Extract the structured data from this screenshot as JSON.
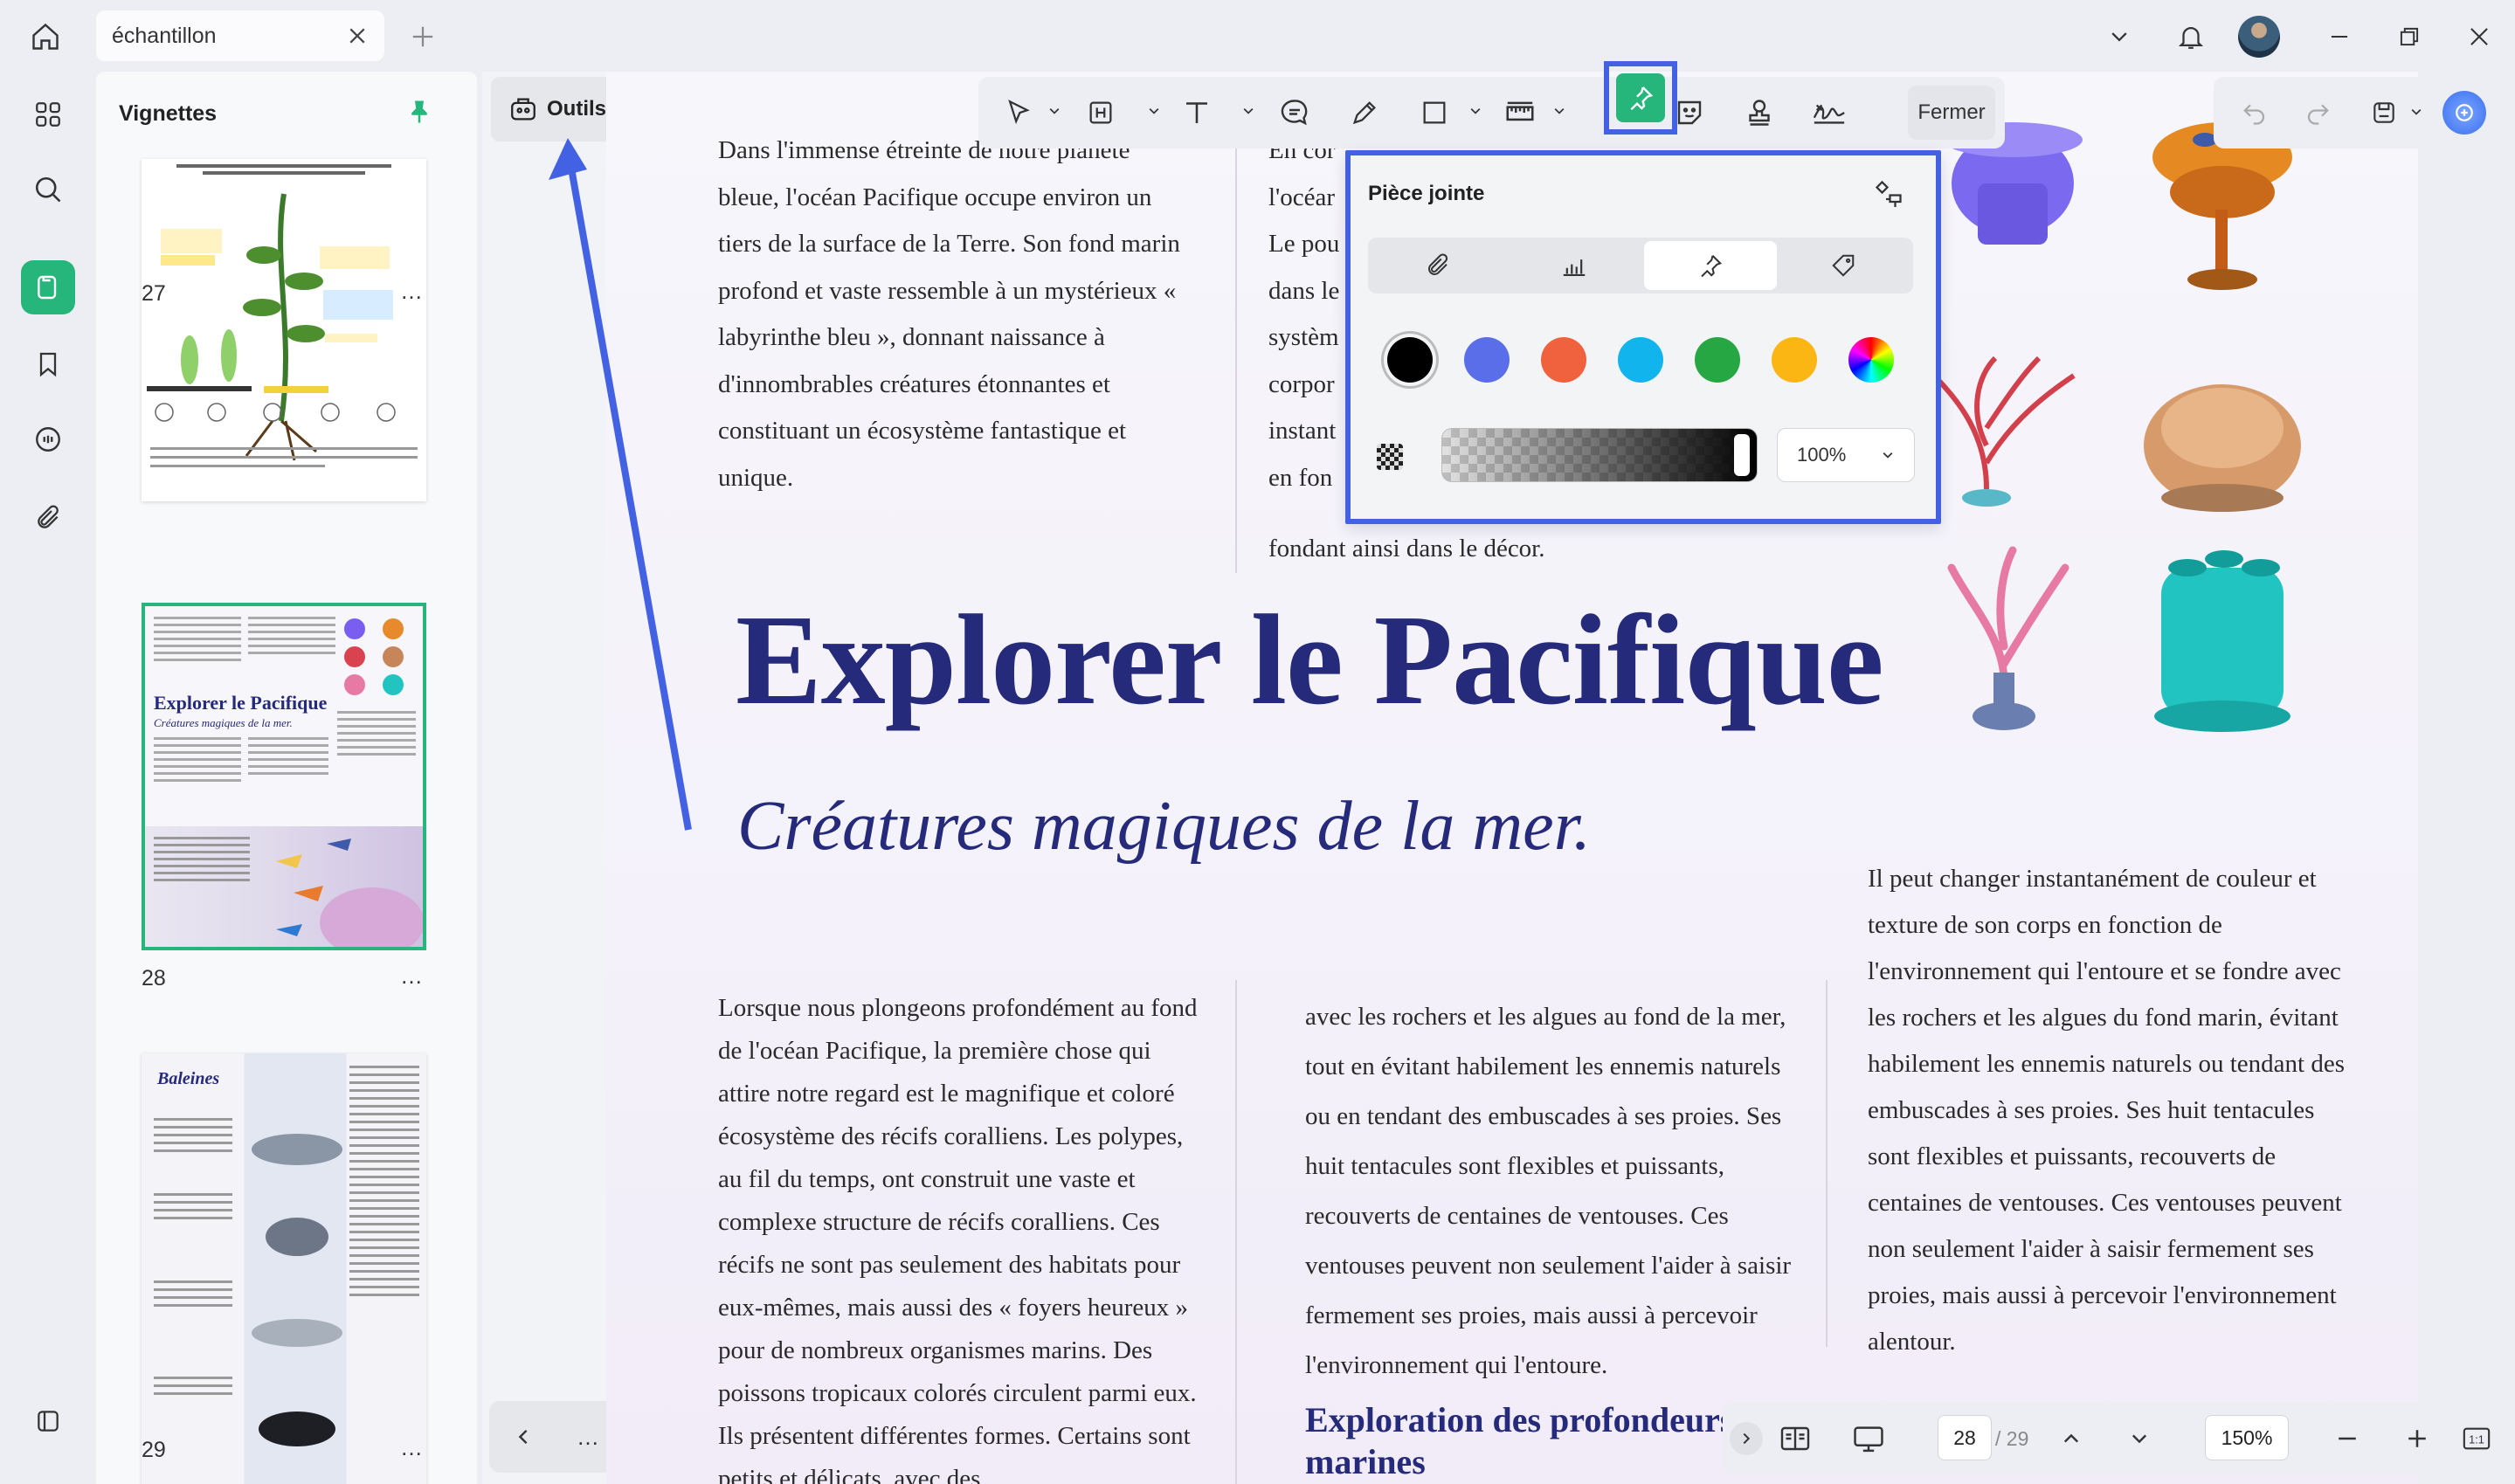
{
  "titlebar": {
    "tab_label": "échantillon"
  },
  "thumbnails": {
    "title": "Vignettes",
    "pages": [
      {
        "number": "27",
        "more": "…"
      },
      {
        "number": "28",
        "more": "…"
      },
      {
        "number": "29",
        "more": "…"
      }
    ],
    "thumb28_title": "Explorer le Pacifique",
    "thumb28_subtitle": "Créatures magiques de la mer.",
    "thumb29_title": "Baleines"
  },
  "tools_panel": {
    "outils_label": "Outils",
    "nav_more": "…"
  },
  "toolbar": {
    "fermer_label": "Fermer"
  },
  "popup": {
    "title": "Pièce jointe",
    "tabs": [
      "paperclip-icon",
      "chart-icon",
      "pin-icon",
      "tag-icon"
    ],
    "selected_tab": "pin-icon",
    "colors": [
      "#000000",
      "#5b6ee9",
      "#f0623d",
      "#11b4ec",
      "#27a644",
      "#fbb614",
      "rainbow"
    ],
    "selected_color": "#000000",
    "opacity": "100%"
  },
  "document": {
    "col1_top": "Dans l'immense étreinte de notre planète bleue, l'océan Pacifique occupe environ un tiers de la surface de la Terre. Son fond marin profond et vaste ressemble à un mystérieux « labyrinthe bleu », donnant naissance à d'innombrables créatures étonnantes et constituant un écosystème fantastique et unique.",
    "col2_top_lines": [
      "En cor",
      "l'océar",
      "Le pou",
      "dans le",
      "systèm",
      "corpor",
      "instant",
      "en fon"
    ],
    "col2_top_last": "fondant ainsi dans le décor.",
    "title": "Explorer le Pacifique",
    "subtitle": "Créatures magiques de la mer.",
    "col1_bottom": "Lorsque nous plongeons profondément au fond de l'océan Pacifique, la première chose qui attire notre regard est le magnifique et coloré écosystème des récifs coralliens. Les polypes, au fil du temps, ont construit une vaste et complexe structure de récifs coralliens. Ces récifs ne sont pas seulement des habitats pour eux-mêmes, mais aussi des « foyers heureux » pour de nombreux organismes marins. Des poissons tropicaux colorés circulent parmi eux. Ils présentent différentes formes. Certains sont petits et délicats, avec des",
    "col2_bottom": "avec les rochers et les algues au fond de la mer, tout en évitant habilement les ennemis naturels ou en tendant des embuscades à ses proies. Ses huit tentacules sont flexibles et puissants, recouverts de centaines de ventouses. Ces ventouses peuvent non seulement l'aider à saisir fermement ses proies, mais aussi à percevoir l'environnement qui l'entoure.",
    "col2_heading": "Exploration des profondeurs marines",
    "col3_bottom": "Il peut changer instantanément de couleur et texture de son corps en fonction de l'environnement qui l'entoure et se fondre avec les rochers et les algues du fond marin, évitant habilement les ennemis naturels ou tendant des embuscades à ses proies. Ses huit tentacules sont flexibles et puissants, recouverts de centaines de ventouses. Ces ventouses peuvent non seulement l'aider à saisir fermement ses proies, mais aussi à percevoir l'environnement alentour."
  },
  "zoombar": {
    "current_page": "28",
    "total_pages": "/ 29",
    "zoom": "150%"
  },
  "accent": "#26b57a",
  "highlight": "#4262e3",
  "title_color": "#252a7a"
}
